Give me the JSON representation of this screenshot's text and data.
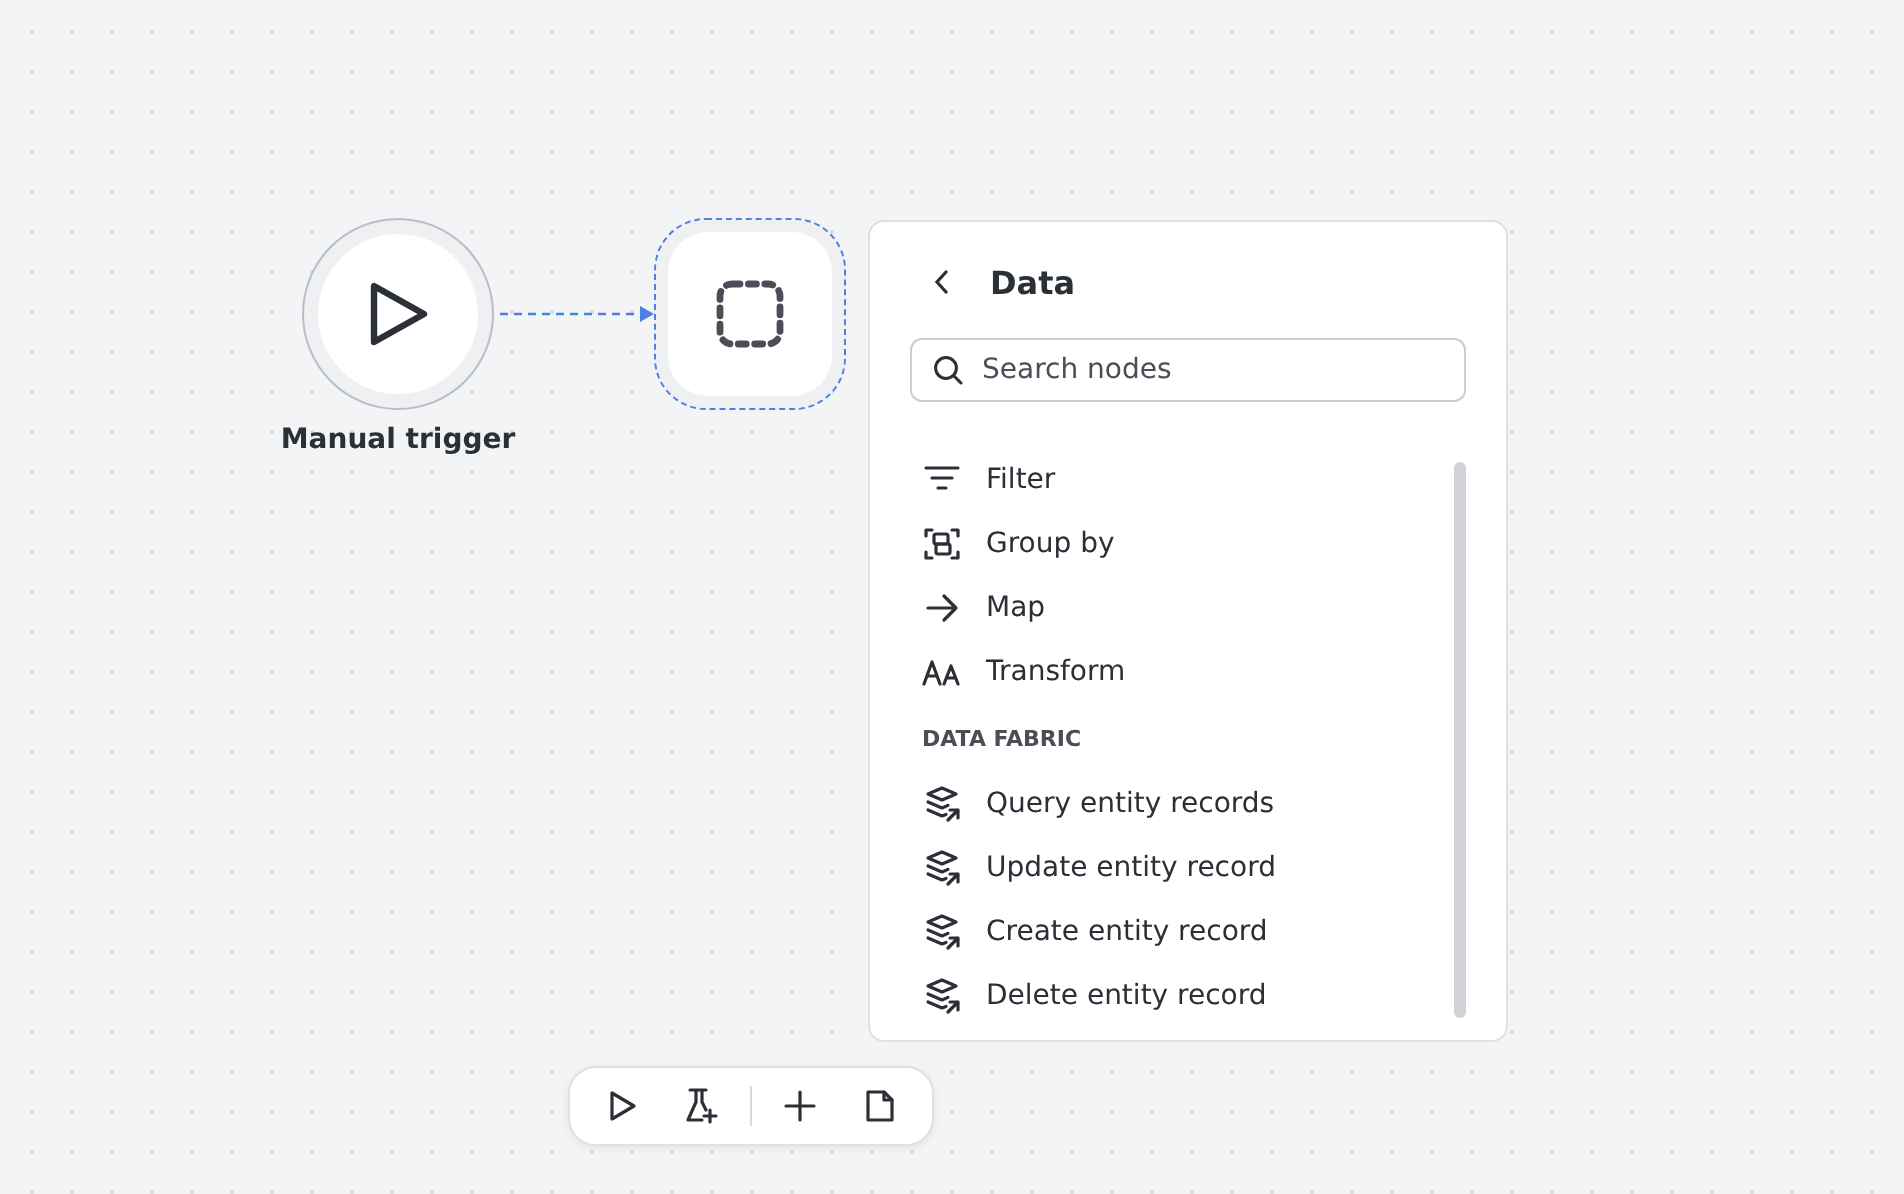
{
  "nodes": [
    {
      "kind": "trigger",
      "label": "Manual trigger",
      "selected": false
    },
    {
      "kind": "placeholder",
      "selected": true
    }
  ],
  "panel": {
    "title": "Data",
    "search": {
      "placeholder": "Search nodes"
    },
    "groups": [
      {
        "items": [
          {
            "label": "Filter",
            "kind": "filter"
          },
          {
            "label": "Group by",
            "kind": "group"
          },
          {
            "label": "Map",
            "kind": "map"
          },
          {
            "label": "Transform",
            "kind": "transform"
          }
        ]
      },
      {
        "heading": "DATA FABRIC",
        "items": [
          {
            "label": "Query entity records",
            "kind": "entity"
          },
          {
            "label": "Update entity record",
            "kind": "entity"
          },
          {
            "label": "Create entity record",
            "kind": "entity"
          },
          {
            "label": "Delete entity record",
            "kind": "entity"
          }
        ]
      }
    ]
  }
}
